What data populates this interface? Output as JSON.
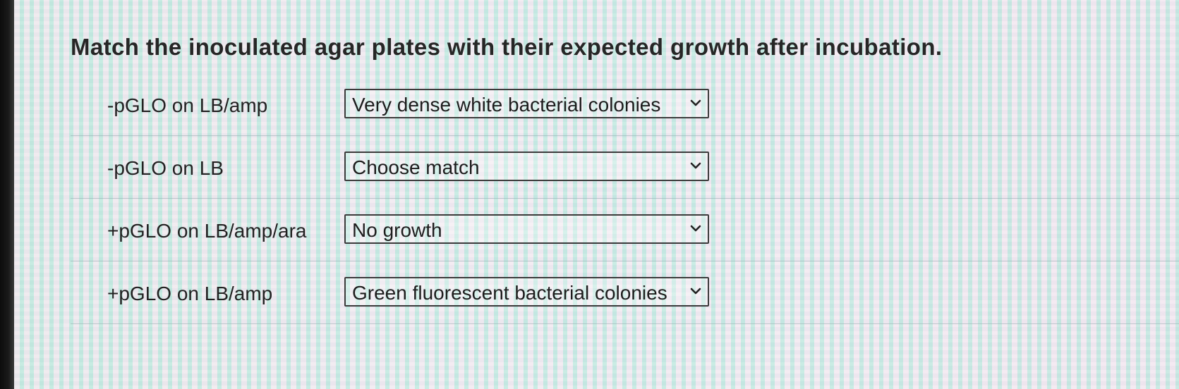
{
  "question": "Match the inoculated agar plates with their expected growth after incubation.",
  "rows": [
    {
      "prompt": "-pGLO on LB/amp",
      "selected": "Very dense white bacterial colonies"
    },
    {
      "prompt": "-pGLO on LB",
      "selected": "Choose match"
    },
    {
      "prompt": "+pGLO on LB/amp/ara",
      "selected": "No growth"
    },
    {
      "prompt": "+pGLO on LB/amp",
      "selected": "Green fluorescent bacterial colonies"
    }
  ],
  "icons": {
    "dropdown": "chevron-down-icon"
  }
}
